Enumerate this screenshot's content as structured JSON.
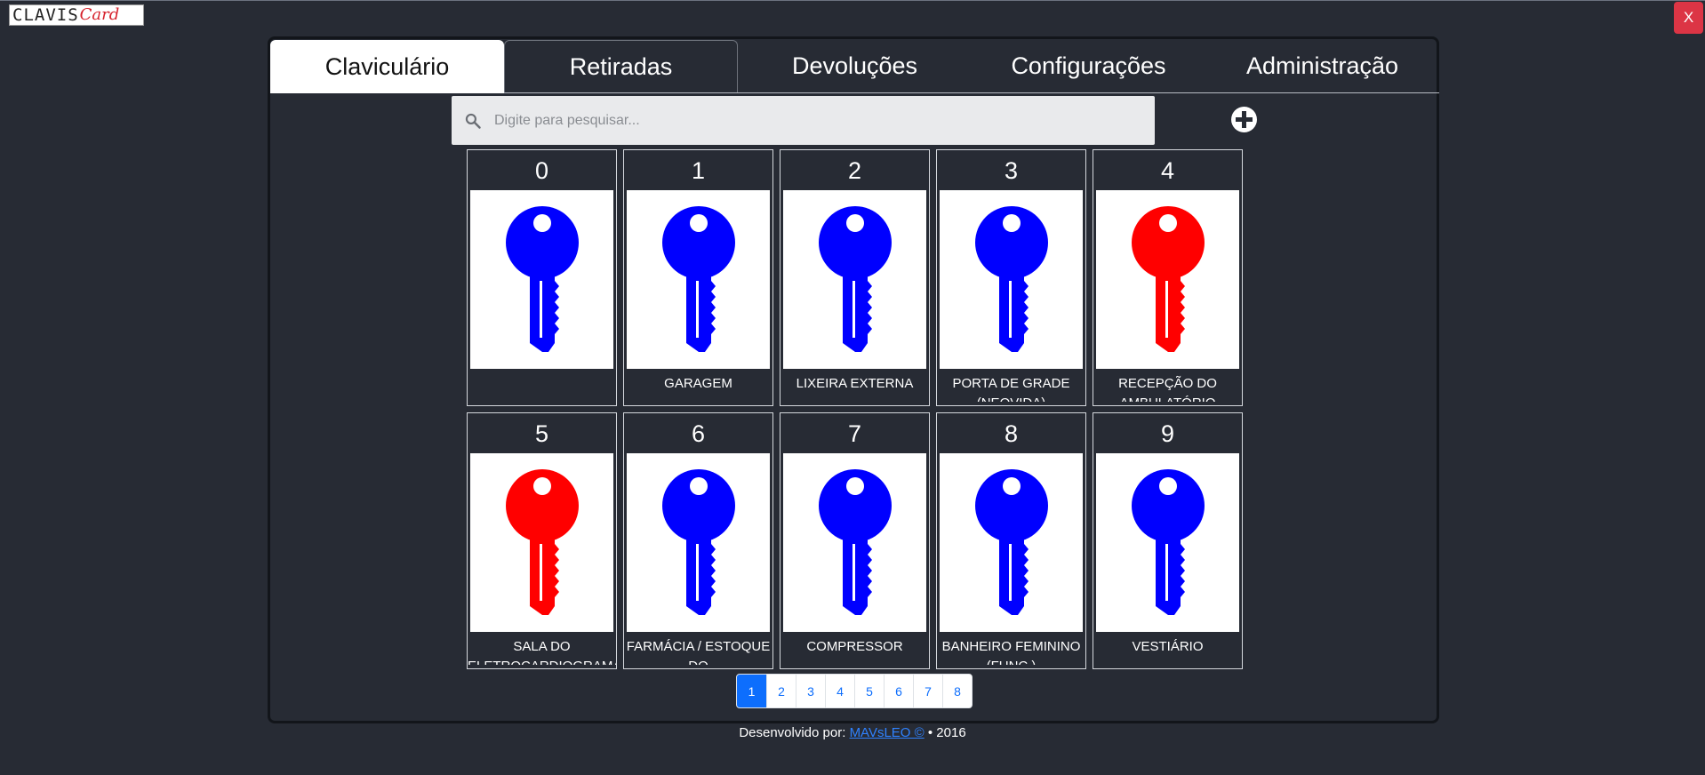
{
  "app": {
    "logo": {
      "part1": "CLAVIS",
      "part2": "Card"
    },
    "close_label": "X"
  },
  "tabs": [
    {
      "label": "Claviculário",
      "active": true
    },
    {
      "label": "Retiradas",
      "active": false
    },
    {
      "label": "Devoluções",
      "active": false
    },
    {
      "label": "Configurações",
      "active": false
    },
    {
      "label": "Administração",
      "active": false
    }
  ],
  "search": {
    "placeholder": "Digite para pesquisar..."
  },
  "colors": {
    "available": "#0000ff",
    "unavailable": "#ff0000",
    "accent": "#0d6efd",
    "close": "#dc3545"
  },
  "keys": [
    {
      "number": "0",
      "label": "",
      "status": "available"
    },
    {
      "number": "1",
      "label": "GARAGEM",
      "status": "available"
    },
    {
      "number": "2",
      "label": "LIXEIRA EXTERNA",
      "status": "available"
    },
    {
      "number": "3",
      "label": "PORTA DE GRADE (NEOVIDA)",
      "status": "available"
    },
    {
      "number": "4",
      "label": "RECEPÇÃO DO AMBULATÓRIO",
      "status": "unavailable"
    },
    {
      "number": "5",
      "label": "SALA DO ELETROCARDIOGRAMA",
      "status": "unavailable"
    },
    {
      "number": "6",
      "label": "FARMÁCIA / ESTOQUE DO",
      "status": "available"
    },
    {
      "number": "7",
      "label": "COMPRESSOR",
      "status": "available"
    },
    {
      "number": "8",
      "label": "BANHEIRO FEMININO (FUNC.)",
      "status": "available"
    },
    {
      "number": "9",
      "label": "VESTIÁRIO",
      "status": "available"
    }
  ],
  "pagination": {
    "pages": [
      "1",
      "2",
      "3",
      "4",
      "5",
      "6",
      "7",
      "8"
    ],
    "current": "1"
  },
  "footer": {
    "prefix": "Desenvolvido por:",
    "link": "MAVsLEO ©",
    "suffix": "• 2016"
  }
}
